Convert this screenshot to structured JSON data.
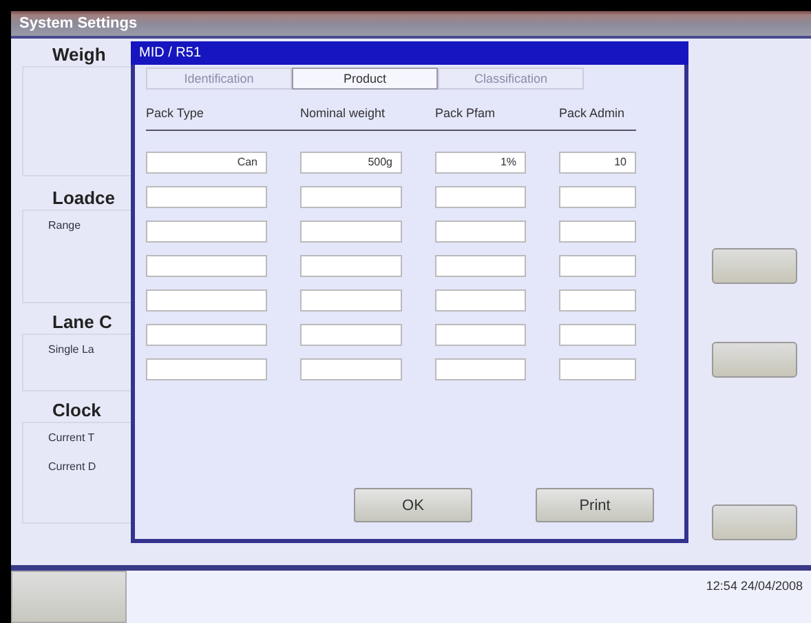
{
  "window": {
    "title": "System Settings"
  },
  "sections": [
    {
      "heading": "Weigh"
    },
    {
      "heading": "Loadce",
      "labels": [
        "Range"
      ]
    },
    {
      "heading": "Lane C",
      "labels": [
        "Single La"
      ]
    },
    {
      "heading": "Clock",
      "labels": [
        "Current T",
        "Current D"
      ]
    }
  ],
  "dialog": {
    "title": "MID / R51",
    "tabs": [
      {
        "label": "Identification",
        "selected": false,
        "disabled": true
      },
      {
        "label": "Product",
        "selected": true,
        "disabled": false
      },
      {
        "label": "Classification",
        "selected": false,
        "disabled": true
      }
    ],
    "columns": [
      "Pack Type",
      "Nominal weight",
      "Pack Pfam",
      "Pack Admin"
    ],
    "rows": [
      {
        "values": [
          "Can",
          "500g",
          "1%",
          "10"
        ]
      },
      {},
      {},
      {},
      {},
      {},
      {}
    ],
    "buttons": [
      "OK",
      "Print"
    ]
  },
  "status_bar": {
    "clock": "12:54 24/04/2008"
  }
}
